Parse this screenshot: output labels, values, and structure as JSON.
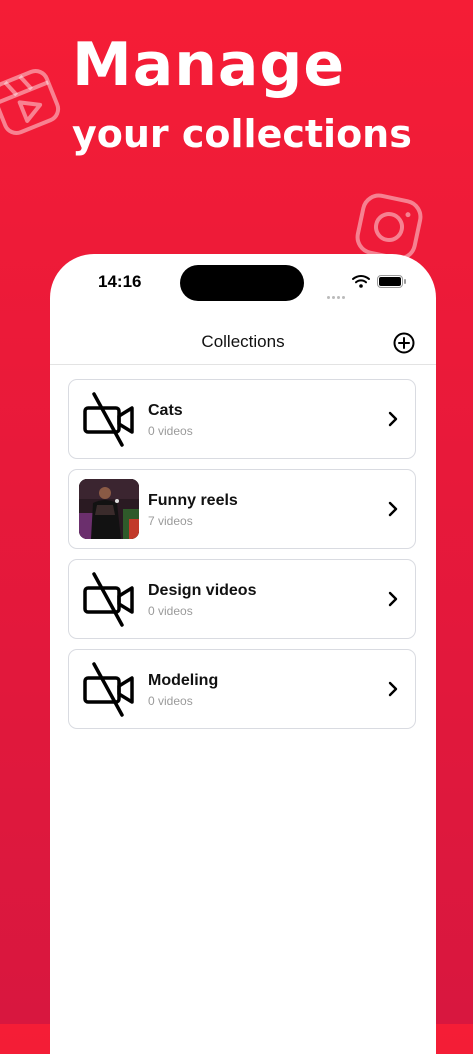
{
  "promo": {
    "line1": "Manage",
    "line2": "your collections"
  },
  "status": {
    "time": "14:16"
  },
  "nav": {
    "title": "Collections",
    "add_icon": "plus-circle-icon"
  },
  "collections": [
    {
      "name": "Cats",
      "count": "0 videos",
      "thumb": "video-off-icon"
    },
    {
      "name": "Funny reels",
      "count": "7 videos",
      "thumb": "photo"
    },
    {
      "name": "Design videos",
      "count": "0 videos",
      "thumb": "video-off-icon"
    },
    {
      "name": "Modeling",
      "count": "0 videos",
      "thumb": "video-off-icon"
    }
  ],
  "colors": {
    "background": "#f51d36",
    "card_border": "#d9dbe1",
    "muted_text": "#9a9a9a"
  }
}
